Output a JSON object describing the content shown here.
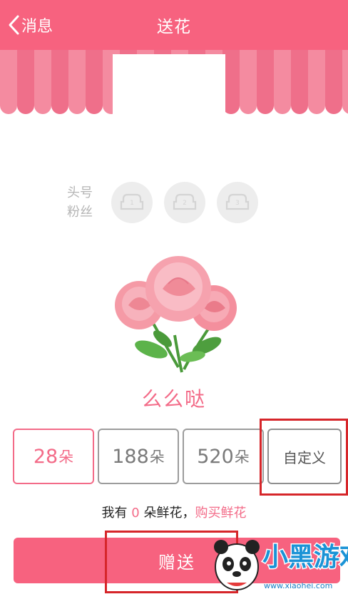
{
  "header": {
    "back_label": "消息",
    "title": "送花"
  },
  "fans": {
    "label_line1": "头号",
    "label_line2": "粉丝",
    "ranks": [
      "1",
      "2",
      "3"
    ]
  },
  "gift": {
    "name": "么么哒"
  },
  "options": [
    {
      "num": "28",
      "unit": "朵",
      "selected": true
    },
    {
      "num": "188",
      "unit": "朵",
      "selected": false
    },
    {
      "num": "520",
      "unit": "朵",
      "selected": false
    }
  ],
  "custom_label": "自定义",
  "stock": {
    "prefix": "我有 ",
    "count": "0",
    "suffix": " 朵鲜花，",
    "buy_link": "购买鲜花"
  },
  "send_button": "赠送",
  "watermark": {
    "logo_text": "小黑游戏",
    "url": "www.xiaohei.com"
  },
  "colors": {
    "brand_pink": "#f7627f",
    "accent_pink": "#f36b88",
    "annotation_red": "#d6262a"
  }
}
